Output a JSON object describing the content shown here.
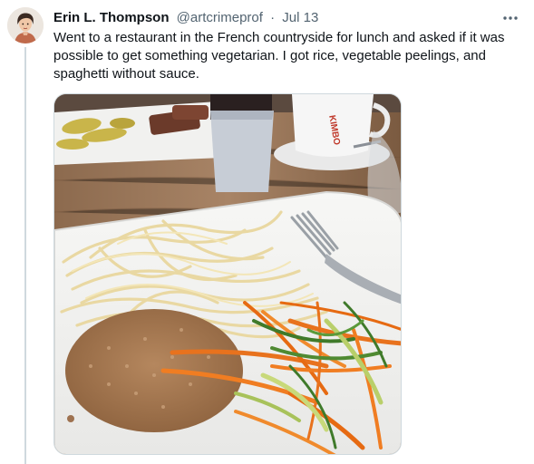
{
  "tweet": {
    "author_name": "Erin L. Thompson",
    "author_handle": "@artcrimeprof",
    "separator": "·",
    "date": "Jul 13",
    "text": "Went to a restaurant in the French countryside for lunch and asked if it was possible to get something vegetarian. I got rice, vegetable peelings, and spaghetti without sauce.",
    "more_icon": "more-horizontal-icon"
  },
  "photo": {
    "cup_brand": "KIMBO"
  },
  "colors": {
    "text_primary": "#0f1419",
    "text_secondary": "#536471",
    "border": "#cfd9de"
  }
}
